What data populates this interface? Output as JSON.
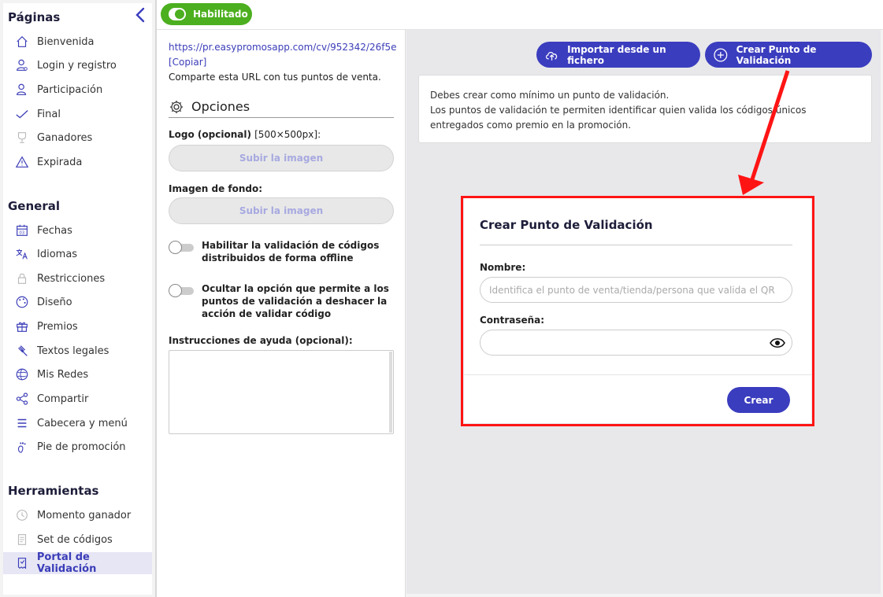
{
  "sidebar": {
    "sections": [
      {
        "title": "Páginas"
      },
      {
        "title": "General"
      },
      {
        "title": "Herramientas"
      }
    ],
    "paginas": [
      {
        "label": "Bienvenida",
        "icon": "house-icon"
      },
      {
        "label": "Login y registro",
        "icon": "user-login-icon"
      },
      {
        "label": "Participación",
        "icon": "user-participation-icon"
      },
      {
        "label": "Final",
        "icon": "check-icon"
      },
      {
        "label": "Ganadores",
        "icon": "trophy-icon"
      },
      {
        "label": "Expirada",
        "icon": "warning-icon"
      }
    ],
    "general": [
      {
        "label": "Fechas",
        "icon": "calendar-icon"
      },
      {
        "label": "Idiomas",
        "icon": "translate-icon"
      },
      {
        "label": "Restricciones",
        "icon": "lock-icon"
      },
      {
        "label": "Diseño",
        "icon": "palette-icon"
      },
      {
        "label": "Premios",
        "icon": "gift-icon"
      },
      {
        "label": "Textos legales",
        "icon": "gavel-icon"
      },
      {
        "label": "Mis Redes",
        "icon": "globe-icon"
      },
      {
        "label": "Compartir",
        "icon": "share-icon"
      },
      {
        "label": "Cabecera y menú",
        "icon": "menu-icon"
      },
      {
        "label": "Pie de promoción",
        "icon": "footprint-icon"
      }
    ],
    "herramientas": [
      {
        "label": "Momento ganador",
        "icon": "clock-icon"
      },
      {
        "label": "Set de códigos",
        "icon": "codes-icon"
      },
      {
        "label": "Portal de Validación",
        "icon": "ticket-icon",
        "active": true
      }
    ]
  },
  "topbar": {
    "status_label": "Habilitado",
    "status_color": "#4caf1f"
  },
  "config": {
    "url": "https://pr.easypromosapp.com/cv/952342/26f5e",
    "copy_label": "[Copiar]",
    "share_text": "Comparte esta URL con tus puntos de venta.",
    "options_title": "Opciones",
    "logo_label": "Logo (opcional)",
    "logo_size": "[500×500px]:",
    "upload_label": "Subir la imagen",
    "background_label": "Imagen de fondo:",
    "toggle_offline": "Habilitar la validación de códigos distribuidos de forma offline",
    "toggle_undo": "Ocultar la opción que permite a los puntos de validación a deshacer la acción de validar código",
    "help_label": "Instrucciones de ayuda (opcional):"
  },
  "content": {
    "import_button": "Importar desde un fichero",
    "create_button": "Crear Punto de Validación",
    "info_text": "Debes crear como mínimo un punto de validación.\nLos puntos de validación te permiten identificar quien valida los códigos únicos entregados como premio en la promoción."
  },
  "modal": {
    "title": "Crear Punto de Validación",
    "name_label": "Nombre:",
    "name_placeholder": "Identifica el punto de venta/tienda/persona que valida el QR",
    "password_label": "Contraseña:",
    "submit_label": "Crear"
  },
  "colors": {
    "accent": "#3b3dbf",
    "highlight": "#ff1414",
    "active_bg": "#e6e6f5"
  }
}
